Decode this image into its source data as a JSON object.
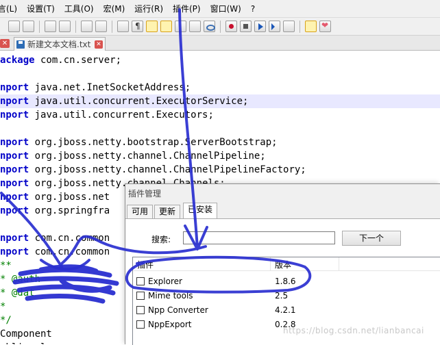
{
  "menubar": {
    "items": [
      "言(L)",
      "设置(T)",
      "工具(O)",
      "宏(M)",
      "运行(R)",
      "插件(P)",
      "窗口(W)",
      "?"
    ]
  },
  "tabs": [
    {
      "label": "新建文本文档.txt"
    }
  ],
  "editor": {
    "lines": [
      {
        "kw": "ackage",
        "rest": " com.cn.server;"
      },
      {
        "kw": "",
        "rest": ""
      },
      {
        "kw": "nport",
        "rest": " java.net.InetSocketAddress;"
      },
      {
        "kw": "nport",
        "rest": " java.util.concurrent.ExecutorService;"
      },
      {
        "kw": "nport",
        "rest": " java.util.concurrent.Executors;"
      },
      {
        "kw": "",
        "rest": ""
      },
      {
        "kw": "nport",
        "rest": " org.jboss.netty.bootstrap.ServerBootstrap;"
      },
      {
        "kw": "nport",
        "rest": " org.jboss.netty.channel.ChannelPipeline;"
      },
      {
        "kw": "nport",
        "rest": " org.jboss.netty.channel.ChannelPipelineFactory;"
      },
      {
        "kw": "nport",
        "rest": " org.jboss.netty.channel.Channels;"
      },
      {
        "kw": "nport",
        "rest": " org.jboss.net"
      },
      {
        "kw": "nport",
        "rest": " org.springfra"
      },
      {
        "kw": "",
        "rest": ""
      },
      {
        "kw": "nport",
        "rest": " com.cn.common"
      },
      {
        "kw": "nport",
        "rest": " com.cn.common"
      },
      {
        "kw": "",
        "rest": "**",
        "comment": true
      },
      {
        "kw": "",
        "rest": "* @auth",
        "comment": true
      },
      {
        "kw": "",
        "rest": "* @dat",
        "comment": true
      },
      {
        "kw": "",
        "rest": "*",
        "comment": true
      },
      {
        "kw": "",
        "rest": "*/",
        "comment": true
      },
      {
        "kw": "",
        "rest": "Component"
      },
      {
        "kw": "",
        "rest": "ublic cl"
      }
    ]
  },
  "dialog": {
    "title": "插件管理",
    "tabs": [
      "可用",
      "更新",
      "已安装"
    ],
    "search_label": "搜索:",
    "search_value": "",
    "next_button": "下一个",
    "columns": [
      "插件",
      "版本"
    ],
    "plugins": [
      {
        "name": "Explorer",
        "version": "1.8.6"
      },
      {
        "name": "Mime tools",
        "version": "2.5"
      },
      {
        "name": "Npp Converter",
        "version": "4.2.1"
      },
      {
        "name": "NppExport",
        "version": "0.2.8"
      }
    ]
  },
  "watermark": "https://blog.csdn.net/lianbancai",
  "colors": {
    "keyword": "#0000c8",
    "current_line": "#e8e8ff",
    "annotation_ink": "#2a2fd0"
  }
}
